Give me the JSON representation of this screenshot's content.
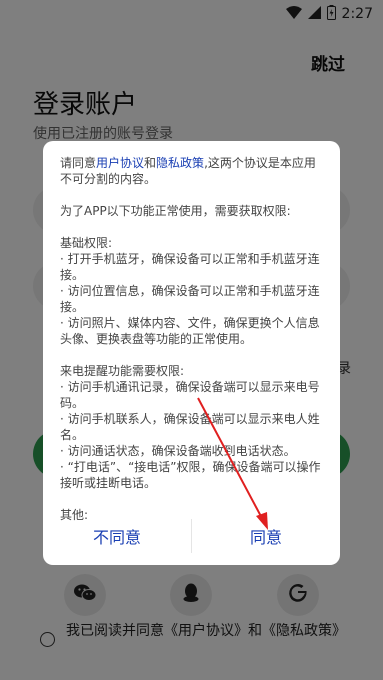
{
  "status": {
    "time": "2:27"
  },
  "header": {
    "skip_label": "跳过"
  },
  "login": {
    "title": "登录账户",
    "subtitle": "使用已注册的账号登录",
    "side_text": "录"
  },
  "agreement": {
    "text": "我已阅读并同意《用户协议》和《隐私政策》"
  },
  "social": [
    "wechat-icon",
    "qq-icon",
    "google-icon"
  ],
  "dialog": {
    "intro_prefix": "请同意",
    "user_agreement": "用户协议",
    "and": "和",
    "privacy_policy": "隐私政策",
    "intro_suffix": ",这两个协议是本应用不可分割的内容。",
    "purpose": "为了APP以下功能正常使用，需要获取权限:",
    "basic_title": "基础权限:",
    "basic_items": [
      "· 打开手机蓝牙，确保设备可以正常和手机蓝牙连接。",
      "· 访问位置信息，确保设备可以正常和手机蓝牙连接。",
      "· 访问照片、媒体内容、文件，确保更换个人信息头像、更换表盘等功能的正常使用。"
    ],
    "call_title": "来电提醒功能需要权限:",
    "call_items": [
      "· 访问手机通讯记录，确保设备端可以显示来电号码。",
      "· 访问手机联系人，确保设备端可以显示来电人姓名。",
      "· 访问通话状态，确保设备端收到电话状态。",
      "· “打电话”、“接电话”权限，确保设备端可以操作接听或挂断电话。"
    ],
    "other_title": "其他:",
    "disagree_label": "不同意",
    "agree_label": "同意"
  }
}
